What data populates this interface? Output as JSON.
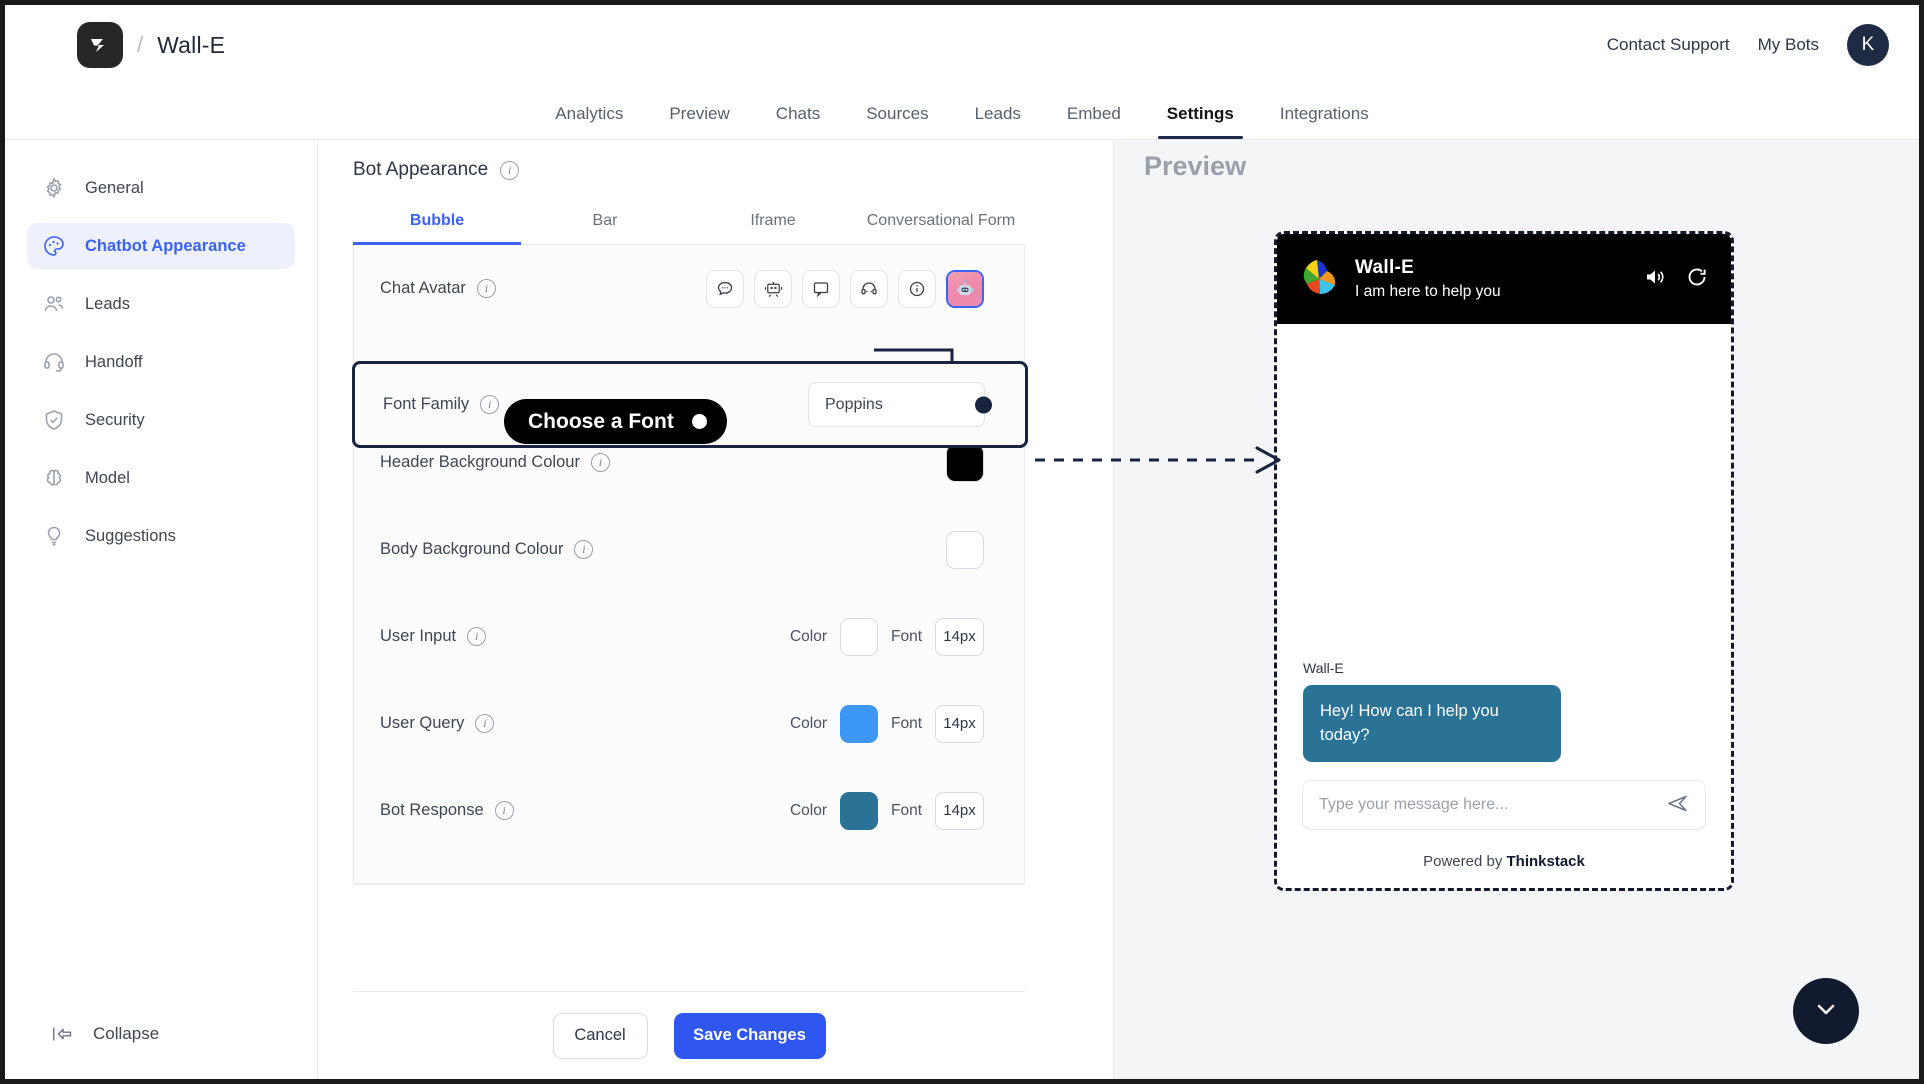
{
  "topbar": {
    "separator": "/",
    "bot_name": "Wall-E",
    "links": [
      "Contact Support",
      "My Bots"
    ],
    "avatar_initial": "K"
  },
  "nav": {
    "tabs": [
      "Analytics",
      "Preview",
      "Chats",
      "Sources",
      "Leads",
      "Embed",
      "Settings",
      "Integrations"
    ],
    "active": "Settings"
  },
  "sidebar": {
    "items": [
      {
        "label": "General",
        "icon": "gear-icon"
      },
      {
        "label": "Chatbot Appearance",
        "icon": "palette-icon"
      },
      {
        "label": "Leads",
        "icon": "users-icon"
      },
      {
        "label": "Handoff",
        "icon": "headset-icon"
      },
      {
        "label": "Security",
        "icon": "shield-check-icon"
      },
      {
        "label": "Model",
        "icon": "brain-icon"
      },
      {
        "label": "Suggestions",
        "icon": "lightbulb-icon"
      }
    ],
    "active": "Chatbot Appearance",
    "collapse_label": "Collapse"
  },
  "panel": {
    "title": "Bot Appearance",
    "seg_tabs": [
      "Bubble",
      "Bar",
      "Iframe",
      "Conversational Form"
    ],
    "seg_active": "Bubble",
    "rows": {
      "chat_avatar": {
        "label": "Chat Avatar",
        "options": [
          "chat-bubble-icon",
          "robot-face-icon",
          "speech-box-icon",
          "headset-bot-icon",
          "info-circle-icon",
          "robot-photo-avatar"
        ],
        "selected_index": 5
      },
      "font_family": {
        "label": "Font Family",
        "value": "Poppins"
      },
      "header_bg": {
        "label": "Header Background Colour",
        "color": "#000000"
      },
      "body_bg": {
        "label": "Body Background Colour",
        "color": "#ffffff"
      },
      "user_input": {
        "label": "User Input",
        "color_label": "Color",
        "color": "#ffffff",
        "font_label": "Font",
        "font_size": "14px"
      },
      "user_query": {
        "label": "User Query",
        "color_label": "Color",
        "color": "#3b96f5",
        "font_label": "Font",
        "font_size": "14px"
      },
      "bot_response": {
        "label": "Bot Response",
        "color_label": "Color",
        "color": "#2a7397",
        "font_label": "Font",
        "font_size": "14px"
      }
    },
    "cancel_label": "Cancel",
    "save_label": "Save Changes"
  },
  "tooltip": {
    "text": "Choose a Font"
  },
  "preview": {
    "title": "Preview",
    "widget": {
      "bot_name": "Wall-E",
      "tagline": "I am here to help you",
      "header_icons": [
        "speaker-icon",
        "refresh-icon"
      ],
      "message_sender": "Wall-E",
      "message_text": "Hey! How can I help you today?",
      "input_placeholder": "Type your message here...",
      "send_icon": "send-icon",
      "powered_prefix": "Powered by ",
      "powered_brand": "Thinkstack"
    },
    "fab_icon": "chevron-down-icon"
  },
  "colors": {
    "accent_blue": "#3b63f6",
    "save_blue": "#2f56f0",
    "bot_teal": "#2a7397",
    "dark": "#111a2e"
  }
}
